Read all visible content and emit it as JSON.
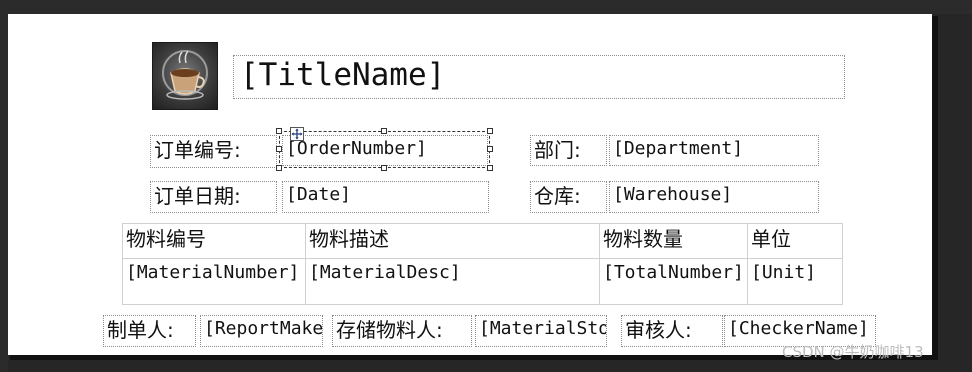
{
  "report": {
    "title": "[TitleName]",
    "logo_icon": "coffee-cup-icon",
    "fields": {
      "order_number_label": "订单编号:",
      "order_number_value": "[OrderNumber]",
      "department_label": "部门:",
      "department_value": "[Department]",
      "order_date_label": "订单日期:",
      "order_date_value": "[Date]",
      "warehouse_label": "仓库:",
      "warehouse_value": "[Warehouse]"
    },
    "table": {
      "headers": [
        "物料编号",
        "物料描述",
        "物料数量",
        "单位"
      ],
      "row": [
        "[MaterialNumber]",
        "[MaterialDesc]",
        "[TotalNumber]",
        "[Unit]"
      ]
    },
    "footer": {
      "maker_label": "制单人:",
      "maker_value": "[ReportMake",
      "storage_label": "存储物料人:",
      "storage_value": "[MaterialSto",
      "checker_label": "审核人:",
      "checker_value": "[CheckerName]"
    }
  },
  "selection": {
    "move_icon": "move-arrows-icon"
  },
  "watermark": "CSDN @牛奶咖啡13"
}
